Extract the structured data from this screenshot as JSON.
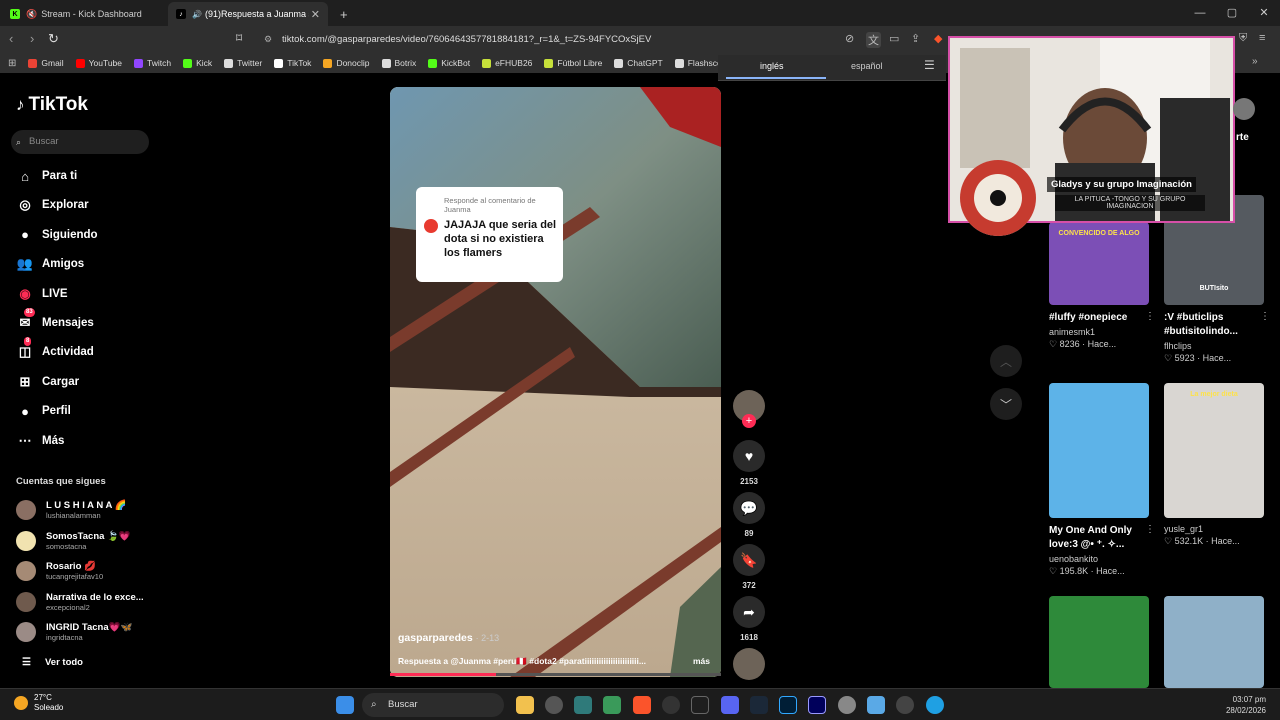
{
  "browser": {
    "tabs": [
      {
        "title": "Stream - Kick Dashboard"
      },
      {
        "title": "(91)Respuesta a Juanma sobr"
      }
    ],
    "new_tab": "+",
    "url": "tiktok.com/@gasparparedes/video/7606464357781884181?_r=1&_t=ZS-94FYCOxSjEV",
    "bookmarks": [
      {
        "label": "Gmail",
        "color": "#ea4335"
      },
      {
        "label": "YouTube",
        "color": "#ff0000"
      },
      {
        "label": "Twitch",
        "color": "#9146ff"
      },
      {
        "label": "Kick",
        "color": "#53fc18"
      },
      {
        "label": "Twitter",
        "color": "#dddddd"
      },
      {
        "label": "TikTok",
        "color": "#ffffff"
      },
      {
        "label": "Donoclip",
        "color": "#f5a623"
      },
      {
        "label": "Botrix",
        "color": "#dddddd"
      },
      {
        "label": "KickBot",
        "color": "#53fc18"
      },
      {
        "label": "eFHUB26",
        "color": "#c6e03a"
      },
      {
        "label": "Fútbol Libre",
        "color": "#c6e03a"
      },
      {
        "label": "ChatGPT",
        "color": "#dddddd"
      },
      {
        "label": "Flashscore",
        "color": "#dddddd"
      }
    ],
    "translate": {
      "lang1": "inglés",
      "lang2": "español"
    }
  },
  "sidebar": {
    "logo": "TikTok",
    "search_placeholder": "Buscar",
    "nav": [
      {
        "label": "Para ti",
        "icon": "home-icon"
      },
      {
        "label": "Explorar",
        "icon": "compass-icon"
      },
      {
        "label": "Siguiendo",
        "icon": "following-avatar-icon"
      },
      {
        "label": "Amigos",
        "icon": "friends-icon"
      },
      {
        "label": "LIVE",
        "icon": "live-icon"
      },
      {
        "label": "Mensajes",
        "icon": "messages-icon",
        "badge": "83"
      },
      {
        "label": "Actividad",
        "icon": "activity-icon",
        "badge": "8"
      },
      {
        "label": "Cargar",
        "icon": "upload-icon"
      },
      {
        "label": "Perfil",
        "icon": "profile-icon"
      },
      {
        "label": "Más",
        "icon": "more-icon"
      }
    ],
    "following_title": "Cuentas que sigues",
    "following": [
      {
        "name": "L U S H I A N A 🌈",
        "user": "lushianalamman",
        "color": "#8a6f63"
      },
      {
        "name": "SomosTacna 🍃💗",
        "user": "somostacna",
        "color": "#f1e3b0"
      },
      {
        "name": "Rosario 💋",
        "user": "tucangrejitafav10",
        "color": "#a58a75"
      },
      {
        "name": "Narrativa de lo exce...",
        "user": "excepcional2",
        "color": "#6f5a4d"
      },
      {
        "name": "INGRID Tacna💗🦋",
        "user": "ingridtacna",
        "color": "#9b8b86"
      }
    ],
    "see_all": "Ver todo"
  },
  "video": {
    "reply_header": "Responde al comentario de Juanma",
    "reply_body": "JAJAJA que seria del dota si no existiera los flamers",
    "author": "gasparparedes",
    "date": "2-13",
    "description": "Respuesta a @Juanma #peru🇵🇪 #dota2 #paratiiiiiiiiiiiiiiiiiiiiiii...",
    "more": "más",
    "progress": 0.32
  },
  "actions": {
    "likes": "2153",
    "comments": "89",
    "saves": "372",
    "shares": "1618"
  },
  "grid": [
    {
      "title": "#luffy #onepiece",
      "user": "animesmk1",
      "stats": "8236 · Hace...",
      "color": "#7c4fb6"
    },
    {
      "title": ":V #buticlips #butisitolindo...",
      "user": "flhclips",
      "stats": "5923 · Hace...",
      "color": "#555a60"
    },
    {
      "title": "My One And Only love:3 @• ⁺. ✧...",
      "user": "uenobankito",
      "stats": "195.8K · Hace...",
      "color": "#5db3e8"
    },
    {
      "title": "",
      "user": "yusle_gr1",
      "stats": "532.1K · Hace...",
      "color": "#d9d6d2"
    },
    {
      "title": "",
      "user": "",
      "stats": "",
      "color": "#2e8a3a"
    },
    {
      "title": "",
      "user": "",
      "stats": "",
      "color": "#8fb0c8"
    }
  ],
  "grid_overlays": {
    "thumb1_text": "CONVENCIDO DE ALGO",
    "thumb2_text": "BUTIsito",
    "thumb4_text": "La mejor dieta"
  },
  "stream_overlay": {
    "song_title": "Gladys y su grupo Imaginación",
    "song_sub": "LA PITUCA -TONGO Y SU GRUPO IMAGINACION",
    "partial_label": "rte"
  },
  "taskbar": {
    "temp": "27°C",
    "weather": "Soleado",
    "search": "Buscar",
    "time": "03:07 pm",
    "date": "28/02/2026"
  }
}
